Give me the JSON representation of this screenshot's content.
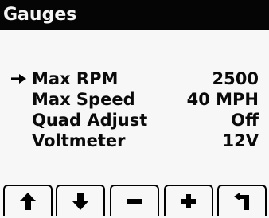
{
  "title": "Gauges",
  "menu": {
    "selected_index": 0,
    "items": [
      {
        "label": "Max RPM",
        "value": "2500"
      },
      {
        "label": "Max Speed",
        "value": "40 MPH"
      },
      {
        "label": "Quad Adjust",
        "value": "Off"
      },
      {
        "label": "Voltmeter",
        "value": "12V"
      }
    ]
  },
  "softkeys": [
    {
      "icon": "arrow-up-icon"
    },
    {
      "icon": "arrow-down-icon"
    },
    {
      "icon": "minus-icon"
    },
    {
      "icon": "plus-icon"
    },
    {
      "icon": "back-icon"
    }
  ],
  "colors": {
    "foreground": "#000000",
    "background": "#f7f7f7"
  }
}
